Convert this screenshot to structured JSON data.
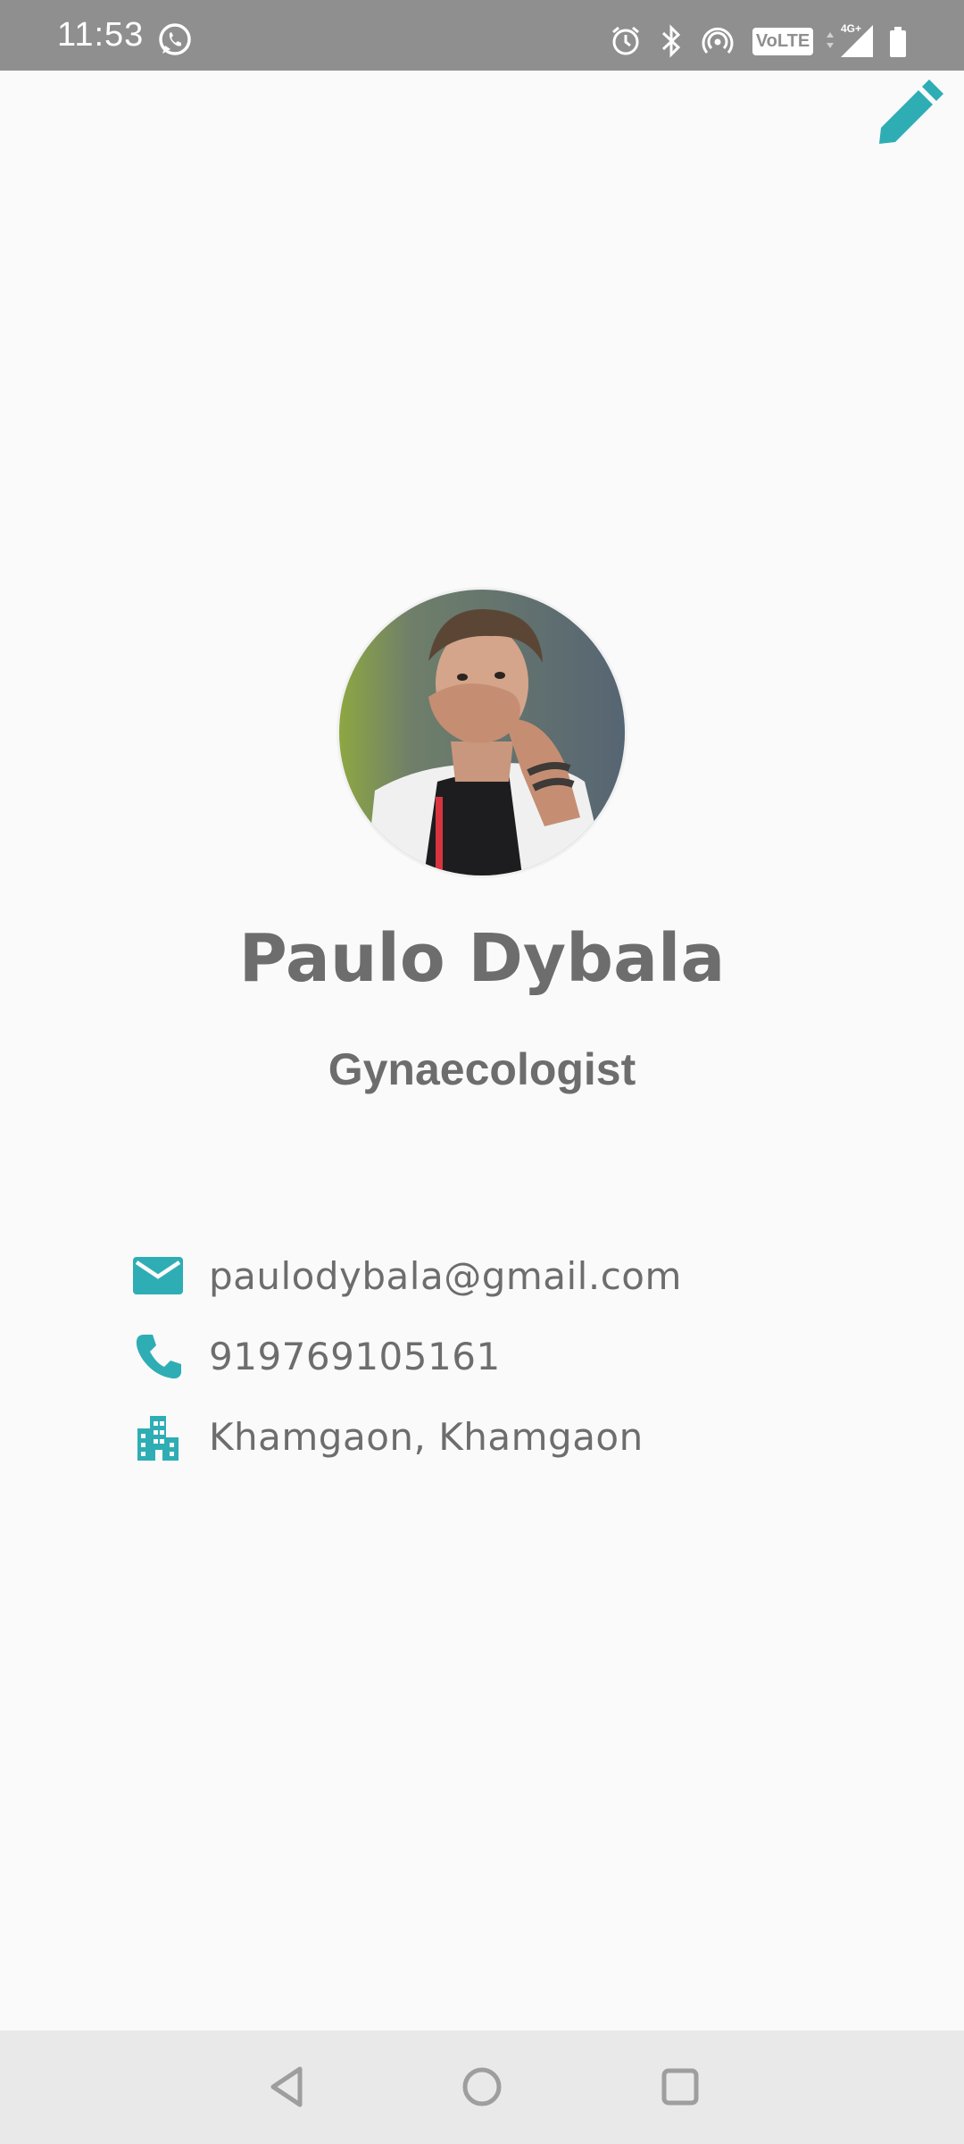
{
  "status_bar": {
    "time": "11:53",
    "volte": "VoLTE",
    "network": "4G+"
  },
  "profile": {
    "name": "Paulo Dybala",
    "title": "Gynaecologist"
  },
  "contact": {
    "email": "paulodybala@gmail.com",
    "phone": "919769105161",
    "location": "Khamgaon, Khamgaon"
  },
  "icons": {
    "edit": "pencil-icon",
    "email": "email-icon",
    "phone": "phone-icon",
    "location": "building-icon",
    "nav_back": "back-triangle-icon",
    "nav_home": "home-circle-icon",
    "nav_recents": "recents-square-icon"
  },
  "colors": {
    "accent": "#2fadb5",
    "text": "#6d6d6d",
    "status_bar": "#8f8f8f",
    "background": "#fafafa"
  }
}
